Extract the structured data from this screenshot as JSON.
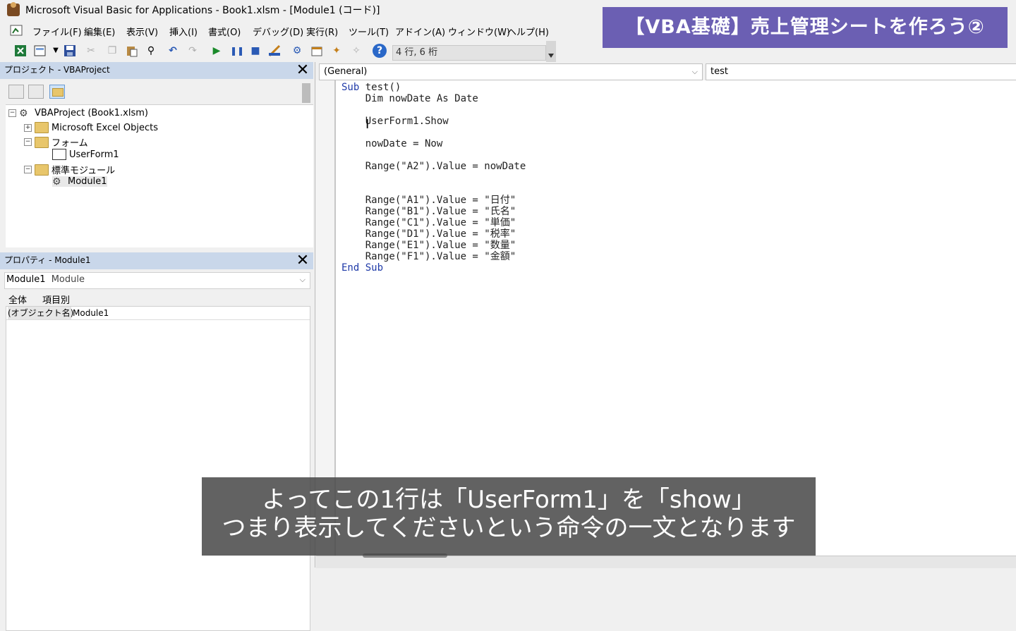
{
  "window": {
    "title": "Microsoft Visual Basic for Applications - Book1.xlsm - [Module1 (コード)]"
  },
  "menu": [
    "ファイル(F)",
    "編集(E)",
    "表示(V)",
    "挿入(I)",
    "書式(O)",
    "デバッグ(D)",
    "実行(R)",
    "ツール(T)",
    "アドイン(A)",
    "ウィンドウ(W)",
    "ヘルプ(H)"
  ],
  "toolbar": {
    "status": "4 行, 6 桁"
  },
  "banner": {
    "text": "【VBA基礎】売上管理シートを作ろう②"
  },
  "project": {
    "title": "プロジェクト - VBAProject",
    "tree": [
      {
        "label": "VBAProject (Book1.xlsm)"
      },
      {
        "label": "Microsoft Excel Objects"
      },
      {
        "label": "フォーム"
      },
      {
        "label": "UserForm1"
      },
      {
        "label": "標準モジュール"
      },
      {
        "label": "Module1"
      }
    ]
  },
  "properties": {
    "title": "プロパティ - Module1",
    "object_name": "Module1",
    "object_type": "Module",
    "tabs": [
      "全体",
      "項目別"
    ],
    "row_key": "(オブジェクト名)",
    "row_value": "Module1"
  },
  "code": {
    "object_combo": "(General)",
    "proc_combo": "test",
    "lines": [
      {
        "kw": "Sub",
        "text": " test()"
      },
      {
        "kw": "",
        "text": "    Dim nowDate As Date"
      },
      {
        "kw": "",
        "text": ""
      },
      {
        "kw": "",
        "text": "    UserForm1.Show"
      },
      {
        "kw": "",
        "text": ""
      },
      {
        "kw": "",
        "text": "    nowDate = Now"
      },
      {
        "kw": "",
        "text": ""
      },
      {
        "kw": "",
        "text": "    Range(\"A2\").Value = nowDate"
      },
      {
        "kw": "",
        "text": ""
      },
      {
        "kw": "",
        "text": ""
      },
      {
        "kw": "",
        "text": "    Range(\"A1\").Value = \"日付\""
      },
      {
        "kw": "",
        "text": "    Range(\"B1\").Value = \"氏名\""
      },
      {
        "kw": "",
        "text": "    Range(\"C1\").Value = \"単価\""
      },
      {
        "kw": "",
        "text": "    Range(\"D1\").Value = \"税率\""
      },
      {
        "kw": "",
        "text": "    Range(\"E1\").Value = \"数量\""
      },
      {
        "kw": "",
        "text": "    Range(\"F1\").Value = \"金額\""
      },
      {
        "kw": "End Sub",
        "text": ""
      }
    ]
  },
  "caption": {
    "line1": "よってこの1行は「UserForm1」を「show」",
    "line2": "つまり表示してくださいという命令の一文となります"
  }
}
